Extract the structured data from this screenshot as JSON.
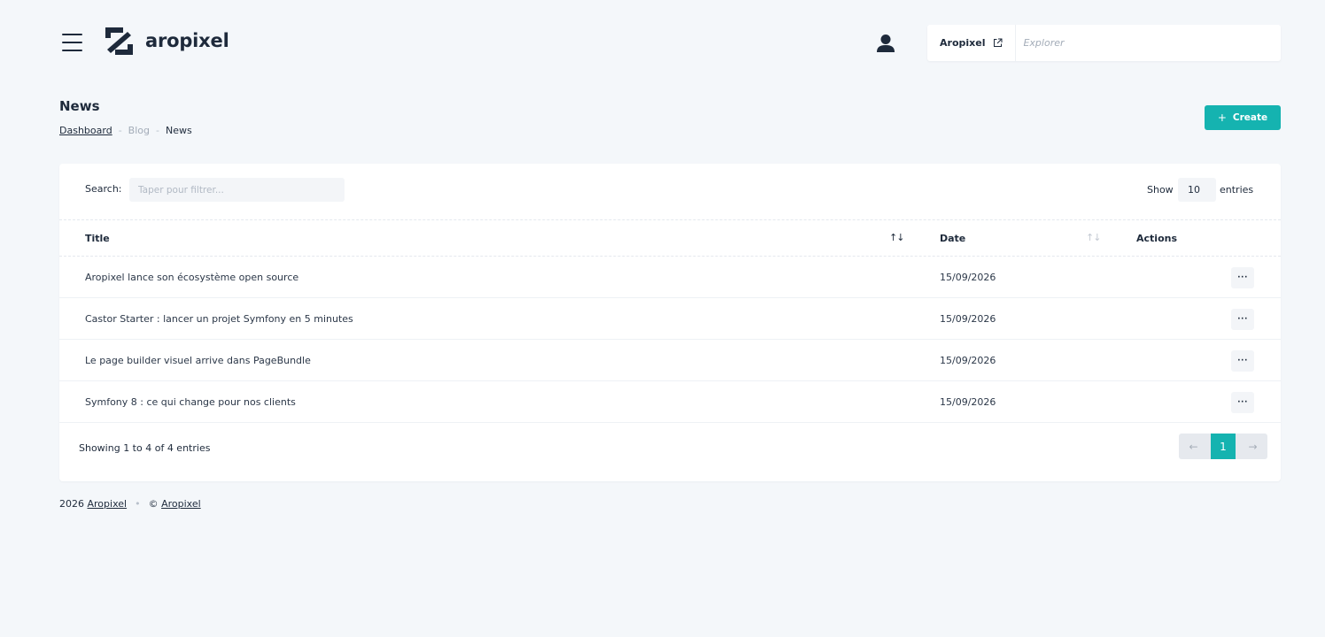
{
  "header": {
    "brand": "aropixel",
    "site_link": "Aropixel",
    "search_placeholder": "Explorer"
  },
  "page": {
    "title": "News",
    "breadcrumb": [
      "Dashboard",
      "Blog",
      "News"
    ],
    "create_label": "Create"
  },
  "table": {
    "search_label": "Search:",
    "search_placeholder": "Taper pour filtrer...",
    "show_label": "Show",
    "page_size": "10",
    "entries_label": "entries",
    "columns": [
      "Title",
      "Date",
      "Actions"
    ],
    "rows": [
      {
        "title": "Aropixel lance son écosystème open source",
        "date": "15/09/2026",
        "action": "···"
      },
      {
        "title": "Castor Starter : lancer un projet Symfony en 5 minutes",
        "date": "15/09/2026",
        "action": "···"
      },
      {
        "title": "Le page builder visuel arrive dans PageBundle",
        "date": "15/09/2026",
        "action": "···"
      },
      {
        "title": "Symfony 8 : ce qui change pour nos clients",
        "date": "15/09/2026",
        "action": "···"
      }
    ],
    "showing_text": "Showing 1 to 4 of 4 entries",
    "pagination": {
      "prev": "←",
      "current": "1",
      "next": "→"
    }
  },
  "footer": {
    "year": "2026",
    "link1": "Aropixel",
    "separator": "•",
    "copyright": "©",
    "link2": "Aropixel"
  },
  "colors": {
    "accent": "#15b3b0",
    "background": "#f4f7fa",
    "text": "#1e2a3b"
  }
}
